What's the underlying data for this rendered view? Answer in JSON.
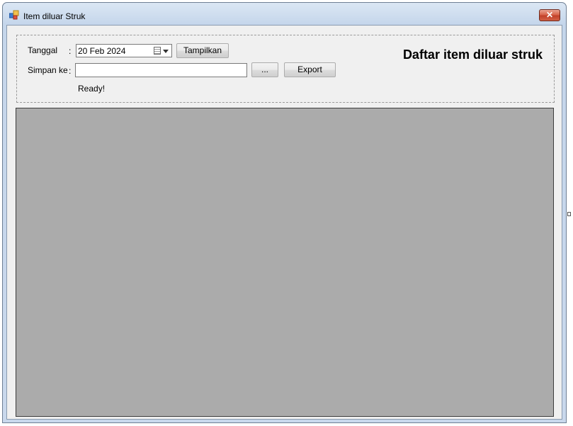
{
  "window": {
    "title": "Item diluar Struk",
    "icon": "app-form-icon",
    "close_label": "✕"
  },
  "form": {
    "tanggal_label": "Tanggal",
    "colon1": ":",
    "date_value": "20 Feb 2024",
    "tampilkan_label": "Tampilkan",
    "simpan_label": "Simpan ke",
    "colon2": ":",
    "save_path_value": "",
    "browse_label": "...",
    "export_label": "Export",
    "status_text": "Ready!",
    "heading": "Daftar item diluar struk"
  },
  "colors": {
    "grid_background": "#ababab",
    "client_background": "#f0f0f0",
    "close_button": "#c94a30"
  }
}
